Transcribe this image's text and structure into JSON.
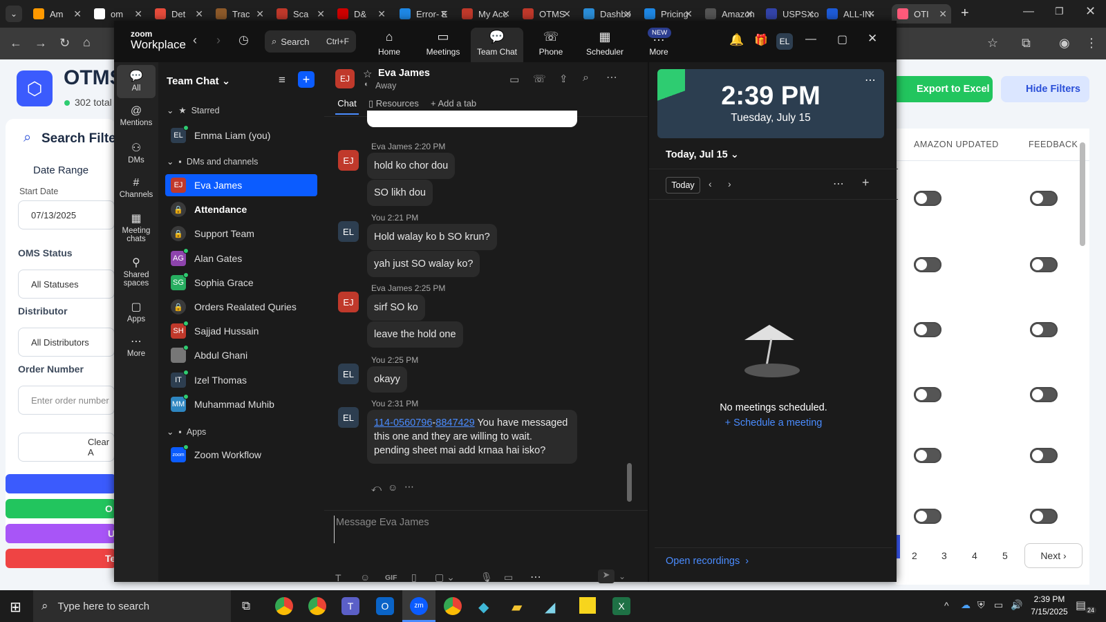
{
  "browser": {
    "tabs": [
      {
        "label": "Am",
        "color": "#ff9900"
      },
      {
        "label": "om",
        "color": "#ffffff"
      },
      {
        "label": "Det",
        "color": "#e74c3c"
      },
      {
        "label": "Trac",
        "color": "#8e5a2a"
      },
      {
        "label": "Sca",
        "color": "#c0392b"
      },
      {
        "label": "D&",
        "color": "#d00000"
      },
      {
        "label": "Error- E",
        "color": "#1e88e5"
      },
      {
        "label": "My Acc",
        "color": "#c0392b"
      },
      {
        "label": "OTMS",
        "color": "#c0392b"
      },
      {
        "label": "Dashbo",
        "color": "#2b8ed8"
      },
      {
        "label": "Pricing",
        "color": "#1e88e5"
      },
      {
        "label": "Amazon",
        "color": "#555555"
      },
      {
        "label": "USPS.co",
        "color": "#3344aa"
      },
      {
        "label": "ALL-IN-",
        "color": "#1d5bd8"
      },
      {
        "label": "OTI",
        "color": "#ff5a7a"
      }
    ]
  },
  "webpage": {
    "app_title": "OTMS",
    "total": "302 total",
    "export_btn": "Export to Excel",
    "hide_filters_btn": "Hide Filters",
    "search_filters": "Search Filters",
    "date_range": "Date Range",
    "start_date_label": "Start Date",
    "start_date_value": "07/13/2025",
    "oms_status": "OMS Status",
    "all_statuses": "All Statuses",
    "distributor": "Distributor",
    "all_distributors": "All Distributors",
    "order_number": "Order Number",
    "order_placeholder": "Enter order number",
    "clear_btn": "Clear A",
    "col_amazon": "AMAZON UPDATED",
    "col_feedback": "FEEDBACK",
    "btn_o": "O",
    "btn_u": "U",
    "btn_te": "Te",
    "pages": [
      "2",
      "3",
      "4",
      "5"
    ],
    "next": "Next"
  },
  "zoom": {
    "brand1": "zoom",
    "brand2": "Workplace",
    "search": "Search",
    "search_shortcut": "Ctrl+F",
    "nav": [
      {
        "label": "Home"
      },
      {
        "label": "Meetings"
      },
      {
        "label": "Team Chat"
      },
      {
        "label": "Phone"
      },
      {
        "label": "Scheduler"
      },
      {
        "label": "More"
      }
    ],
    "new_badge": "NEW",
    "profile": "EL",
    "rail": [
      {
        "label": "All"
      },
      {
        "label": "Mentions"
      },
      {
        "label": "DMs"
      },
      {
        "label": "Channels"
      },
      {
        "label": "Meeting chats"
      },
      {
        "label": "Shared spaces"
      },
      {
        "label": "Apps"
      },
      {
        "label": "More"
      }
    ],
    "sidebar": {
      "title": "Team Chat",
      "starred": "Starred",
      "dms": "DMs and channels",
      "apps": "Apps",
      "items": [
        {
          "name": "Emma Liam (you)",
          "initials": "EL",
          "color": "#2d3e50"
        },
        {
          "name": "Eva James",
          "initials": "EJ",
          "color": "#c0392b"
        },
        {
          "name": "Attendance",
          "initials": "",
          "color": "#3a3a3a"
        },
        {
          "name": "Support Team",
          "initials": "",
          "color": "#3a3a3a"
        },
        {
          "name": "Alan Gates",
          "initials": "AG",
          "color": "#8e44ad"
        },
        {
          "name": "Sophia Grace",
          "initials": "SG",
          "color": "#27ae60"
        },
        {
          "name": "Orders Realated Quries",
          "initials": "",
          "color": "#3a3a3a"
        },
        {
          "name": "Sajjad Hussain",
          "initials": "SH",
          "color": "#c0392b"
        },
        {
          "name": "Abdul Ghani",
          "initials": "",
          "color": "#777777"
        },
        {
          "name": "Izel Thomas",
          "initials": "IT",
          "color": "#2d3e50"
        },
        {
          "name": "Muhammad Muhib",
          "initials": "MM",
          "color": "#2e86c1"
        },
        {
          "name": "Zoom Workflow",
          "initials": "zoom",
          "color": "#0b5cff"
        }
      ]
    },
    "chat": {
      "contact": "Eva James",
      "status": "Away",
      "tab_chat": "Chat",
      "tab_resources": "Resources",
      "tab_add": "Add a tab",
      "messages": [
        {
          "sender": "Eva James",
          "time": "2:20 PM",
          "initials": "EJ",
          "lines": [
            "hold ko chor dou",
            "SO likh dou"
          ]
        },
        {
          "sender": "You",
          "time": "2:21 PM",
          "initials": "EL",
          "lines": [
            "Hold walay ko b SO krun?",
            "yah just SO walay ko?"
          ]
        },
        {
          "sender": "Eva James",
          "time": "2:25 PM",
          "initials": "EJ",
          "lines": [
            "sirf SO ko",
            "leave the hold one"
          ]
        },
        {
          "sender": "You",
          "time": "2:25 PM",
          "initials": "EL",
          "lines": [
            "okayy"
          ]
        },
        {
          "sender": "You",
          "time": "2:31 PM",
          "initials": "EL",
          "link1": "114-0560796",
          "link_sep": "-",
          "link2": "8847429",
          "text": " You have messaged this one and they are willing to wait. pending sheet mai add krnaa hai isko?"
        }
      ],
      "placeholder": "Message Eva James",
      "gif": "GIF"
    },
    "calendar": {
      "time": "2:39 PM",
      "date": "Tuesday, July 15",
      "today_header": "Today, Jul 15",
      "today_btn": "Today",
      "empty": "No meetings scheduled.",
      "schedule": "Schedule a meeting",
      "recordings": "Open recordings"
    }
  },
  "taskbar": {
    "search": "Type here to search",
    "time": "2:39 PM",
    "date": "7/15/2025",
    "notif": "24"
  }
}
